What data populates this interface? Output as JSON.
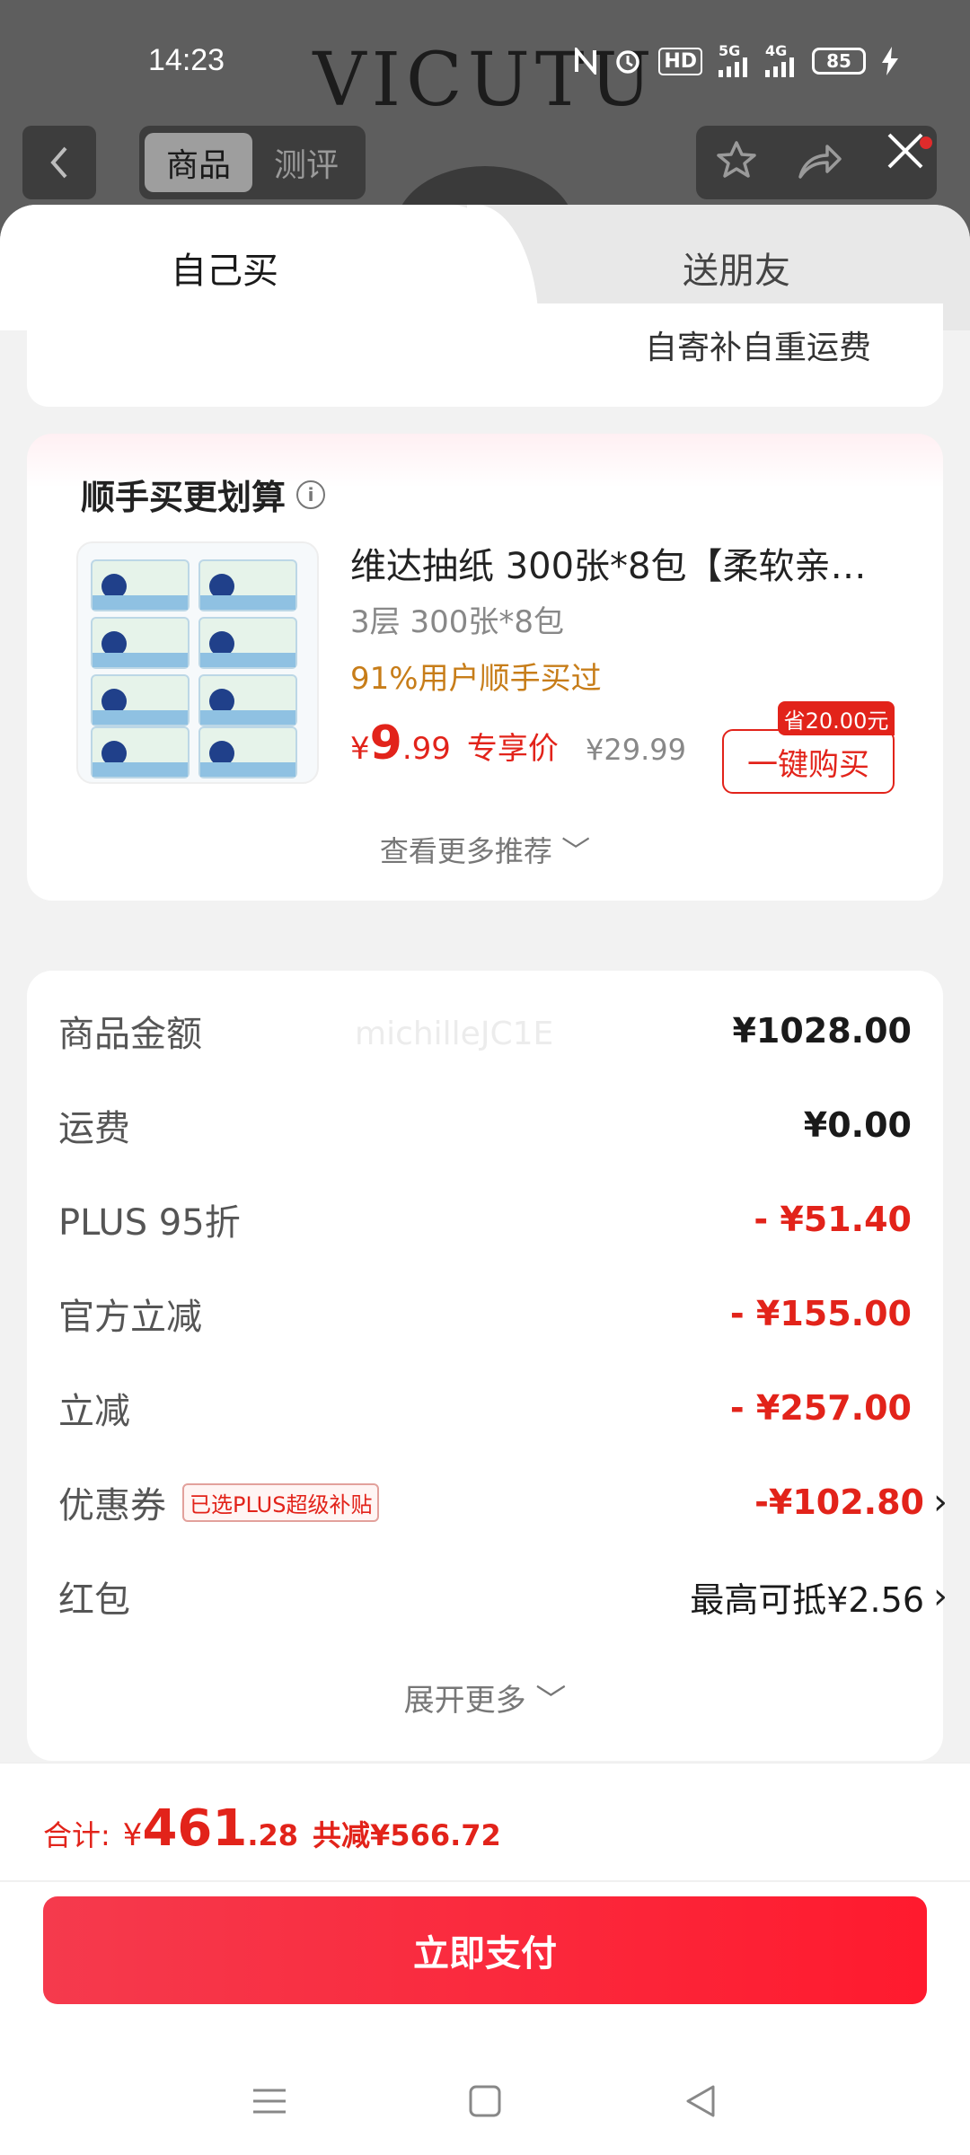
{
  "status_bar": {
    "time": "14:23",
    "icons": [
      "nfc-icon",
      "alarm-icon",
      "hd-icon",
      "signal-5g-icon",
      "signal-4g-icon",
      "battery-icon",
      "charging-icon"
    ],
    "hd_label": "HD",
    "net1": "5G",
    "net2": "4G",
    "battery": "85"
  },
  "header": {
    "brand": "VICUTU",
    "segment": [
      "商品",
      "测评"
    ],
    "active_segment": "商品"
  },
  "sheet_tabs": {
    "self": "自己买",
    "friend": "送朋友"
  },
  "shipping_note": "自寄补自重运费",
  "recommend": {
    "title": "顺手买更划算",
    "product": {
      "name": "维达抽纸 300张*8包【柔软亲…",
      "spec": "3层 300张*8包",
      "bought": "91%用户顺手买过",
      "price_symbol": "¥",
      "price_int": "9",
      "price_dec": ".99",
      "price_tag": "专享价",
      "original_price": "¥29.99",
      "save_badge": "省20.00元",
      "buy_label": "一键购买"
    },
    "more": "查看更多推荐 ﹀"
  },
  "summary": {
    "watermark": "michilleJC1E",
    "rows": [
      {
        "label": "商品金额",
        "value": "¥1028.00"
      },
      {
        "label": "运费",
        "value": "¥0.00"
      },
      {
        "label": "PLUS 95折",
        "value": "- ¥51.40"
      },
      {
        "label": "官方立减",
        "value": "- ¥155.00"
      },
      {
        "label": "立减",
        "value": "- ¥257.00"
      },
      {
        "label": "优惠券",
        "tag": "已选PLUS超级补贴",
        "value": "-¥102.80"
      },
      {
        "label": "红包",
        "value": "最高可抵¥2.56"
      }
    ],
    "expand": "展开更多 ﹀",
    "chevron": "›"
  },
  "footer": {
    "total_label": "合计:",
    "total_symbol": "¥",
    "total_int": "461",
    "total_dec": ".28",
    "total_cut": "共减¥566.72",
    "pay_label": "立即支付"
  },
  "colors": {
    "accent": "#e2231a",
    "pay_gradient_start": "#f53a4d",
    "pay_gradient_end": "#ff1a2e",
    "bought_text": "#c77d19"
  }
}
